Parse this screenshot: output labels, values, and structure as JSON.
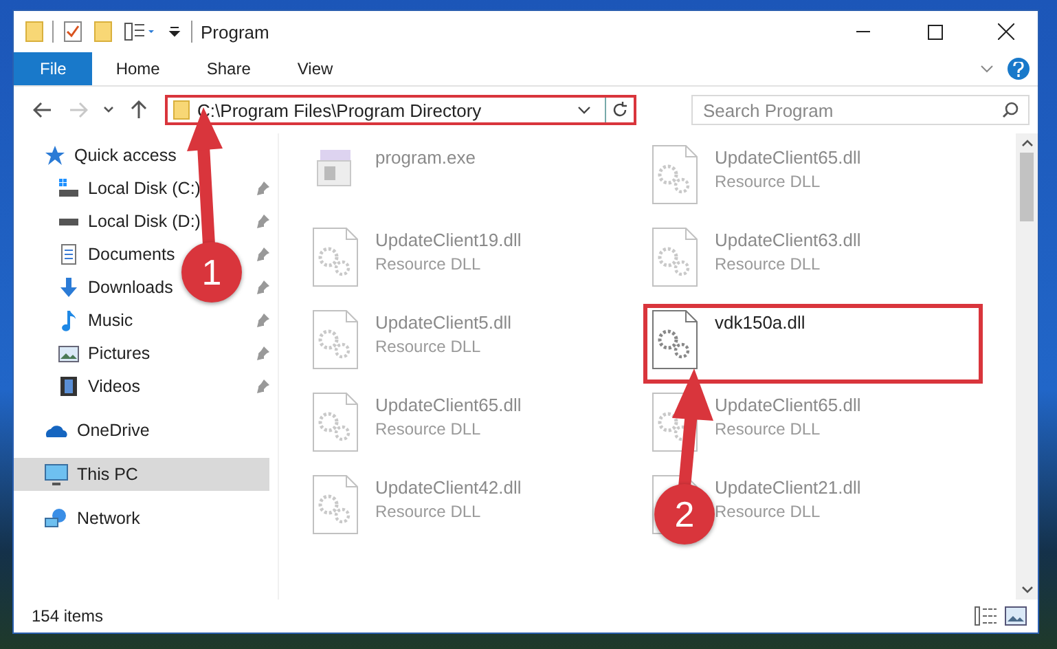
{
  "window": {
    "title": "Program"
  },
  "ribbon_tabs": [
    {
      "label": "File",
      "kind": "file"
    },
    {
      "label": "Home",
      "kind": "tab"
    },
    {
      "label": "Share",
      "kind": "tab"
    },
    {
      "label": "View",
      "kind": "tab"
    }
  ],
  "nav": [
    {
      "kind": "back",
      "disabled": false
    },
    {
      "kind": "forward",
      "disabled": true
    },
    {
      "kind": "recent",
      "disabled": false
    },
    {
      "kind": "up",
      "disabled": false
    }
  ],
  "address_bar": {
    "path": "C:\\Program Files\\Program Directory",
    "highlighted": true
  },
  "search": {
    "placeholder": "Search Program"
  },
  "sidebar": [
    {
      "label": "Quick access",
      "kind": "star",
      "selected": false,
      "children": [
        {
          "label": "Local Disk (C:)",
          "kind": "drive-c",
          "pinned": true,
          "selected": false
        },
        {
          "label": "Local Disk (D:)",
          "kind": "drive",
          "pinned": true,
          "selected": false
        },
        {
          "label": "Documents",
          "kind": "documents",
          "pinned": true,
          "selected": false
        },
        {
          "label": "Downloads",
          "kind": "downloads",
          "pinned": true,
          "selected": false
        },
        {
          "label": "Music",
          "kind": "music",
          "pinned": true,
          "selected": false
        },
        {
          "label": "Pictures",
          "kind": "pictures",
          "pinned": true,
          "selected": false
        },
        {
          "label": "Videos",
          "kind": "videos",
          "pinned": true,
          "selected": false
        }
      ]
    },
    {
      "label": "OneDrive",
      "kind": "cloud",
      "selected": false
    },
    {
      "label": "This PC",
      "kind": "pc",
      "selected": true
    },
    {
      "label": "Network",
      "kind": "network",
      "selected": false
    }
  ],
  "files": [
    {
      "name": "program.exe",
      "kind": "exe",
      "blurred": true,
      "highlighted": false
    },
    {
      "name": "UpdateClient65.dll",
      "type": "Resource DLL",
      "kind": "dll",
      "blurred": true,
      "highlighted": false
    },
    {
      "name": "UpdateClient19.dll",
      "type": "Resource DLL",
      "kind": "dll",
      "blurred": true,
      "highlighted": false
    },
    {
      "name": "UpdateClient63.dll",
      "type": "Resource DLL",
      "kind": "dll",
      "blurred": true,
      "highlighted": false
    },
    {
      "name": "UpdateClient5.dll",
      "type": "Resource DLL",
      "kind": "dll",
      "blurred": true,
      "highlighted": false
    },
    {
      "name": "vdk150a.dll",
      "kind": "dll",
      "blurred": false,
      "highlighted": true
    },
    {
      "name": "UpdateClient65.dll",
      "type": "Resource DLL",
      "kind": "dll",
      "blurred": true,
      "highlighted": false
    },
    {
      "name": "UpdateClient65.dll",
      "type": "Resource DLL",
      "kind": "dll",
      "blurred": true,
      "highlighted": false
    },
    {
      "name": "UpdateClient42.dll",
      "type": "Resource DLL",
      "kind": "dll",
      "blurred": true,
      "highlighted": false
    },
    {
      "name": "UpdateClient21.dll",
      "type": "Resource DLL",
      "kind": "dll",
      "blurred": true,
      "highlighted": false
    }
  ],
  "status_bar": {
    "count": "154 items"
  },
  "annotations": [
    {
      "number": "1"
    },
    {
      "number": "2"
    }
  ]
}
